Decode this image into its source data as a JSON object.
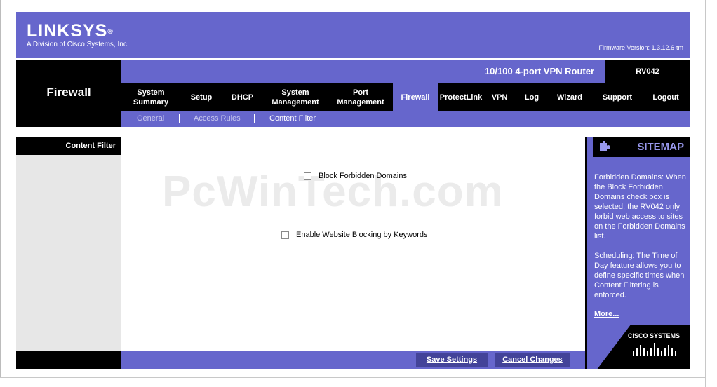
{
  "header": {
    "logo_text": "LINKSYS",
    "logo_registered": "®",
    "logo_subtitle": "A Division of Cisco Systems, Inc.",
    "firmware": "Firmware Version: 1.3.12.6-tm"
  },
  "section_title": "Firewall",
  "product": {
    "name": "10/100 4-port VPN Router",
    "model": "RV042"
  },
  "tabs": [
    {
      "label": "System Summary"
    },
    {
      "label": "Setup"
    },
    {
      "label": "DHCP"
    },
    {
      "label": "System Management"
    },
    {
      "label": "Port Management"
    },
    {
      "label": "Firewall"
    },
    {
      "label": "ProtectLink"
    },
    {
      "label": "VPN"
    },
    {
      "label": "Log"
    },
    {
      "label": "Wizard"
    },
    {
      "label": "Support"
    },
    {
      "label": "Logout"
    }
  ],
  "subnav": [
    {
      "label": "General"
    },
    {
      "label": "Access Rules"
    },
    {
      "label": "Content Filter"
    }
  ],
  "left_col_title": "Content Filter",
  "watermark": "PcWinTech.com",
  "options": {
    "block_forbidden": "Block Forbidden Domains",
    "keyword_blocking": "Enable Website Blocking by Keywords"
  },
  "sidebar": {
    "title": "SITEMAP",
    "help_1": "Forbidden Domains: When the Block Forbidden Domains check box is selected, the RV042 only forbid web access to sites on the Forbidden Domains list.",
    "help_2": "Scheduling: The Time of Day feature allows you to define specific times when Content Filtering is enforced.",
    "more": "More...",
    "cisco": "CISCO SYSTEMS"
  },
  "footer": {
    "save": "Save Settings",
    "cancel": "Cancel Changes"
  },
  "colors": {
    "accent": "#6666cc",
    "dark": "#000000"
  }
}
